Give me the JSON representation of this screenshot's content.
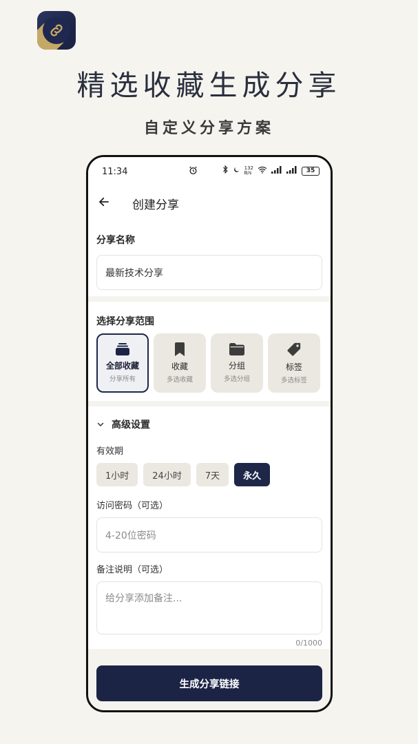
{
  "promo": {
    "title": "精选收藏生成分享",
    "subtitle": "自定义分享方案"
  },
  "status_bar": {
    "time": "11:34",
    "net_speed_top": "132",
    "net_speed_bottom": "B/s",
    "battery": "35"
  },
  "header": {
    "title": "创建分享"
  },
  "share_name": {
    "label": "分享名称",
    "value": "最新技术分享"
  },
  "scope": {
    "label": "选择分享范围",
    "options": [
      {
        "title": "全部收藏",
        "subtitle": "分享所有",
        "icon": "stack-icon"
      },
      {
        "title": "收藏",
        "subtitle": "多选收藏",
        "icon": "bookmark-icon"
      },
      {
        "title": "分组",
        "subtitle": "多选分组",
        "icon": "folder-icon"
      },
      {
        "title": "标签",
        "subtitle": "多选标签",
        "icon": "tag-icon"
      }
    ],
    "selected": "全部收藏"
  },
  "advanced": {
    "label": "高级设置",
    "validity_label": "有效期",
    "validity_options": [
      "1小时",
      "24小时",
      "7天",
      "永久"
    ],
    "validity_selected": "永久",
    "password_label": "访问密码（可选）",
    "password_placeholder": "4-20位密码",
    "note_label": "备注说明（可选）",
    "note_placeholder": "给分享添加备注...",
    "note_counter": "0/1000"
  },
  "submit_label": "生成分享链接",
  "colors": {
    "primary": "#1c2446",
    "background": "#f5f4ef",
    "chip": "#ebe8e1",
    "gold": "#c6a866"
  }
}
